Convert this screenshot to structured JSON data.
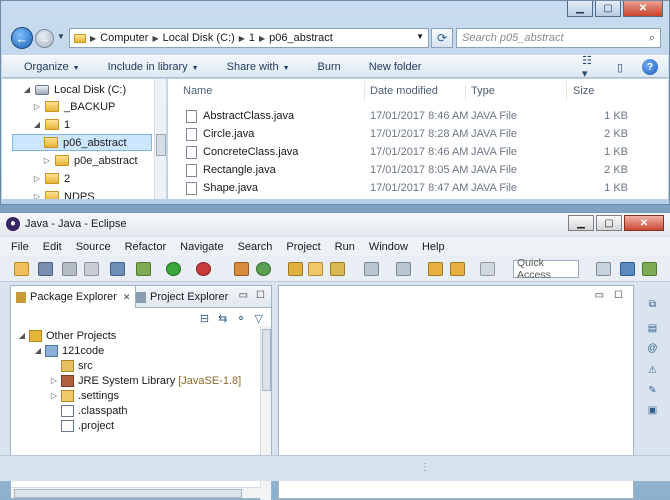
{
  "explorer": {
    "breadcrumb": [
      "Computer",
      "Local Disk (C:)",
      "1",
      "p06_abstract"
    ],
    "search_placeholder": "Search p05_abstract",
    "commands": {
      "organize": "Organize",
      "include": "Include in library",
      "share": "Share with",
      "burn": "Burn",
      "new_folder": "New folder"
    },
    "tree": [
      {
        "label": "Local Disk (C:)",
        "kind": "drive"
      },
      {
        "label": "_BACKUP",
        "kind": "folder"
      },
      {
        "label": "1",
        "kind": "folder"
      },
      {
        "label": "p06_abstract",
        "kind": "folder",
        "selected": true
      },
      {
        "label": "p0e_abstract",
        "kind": "folder"
      },
      {
        "label": "2",
        "kind": "folder"
      },
      {
        "label": "NDPS",
        "kind": "folder"
      }
    ],
    "columns": {
      "name": "Name",
      "date": "Date modified",
      "type": "Type",
      "size": "Size"
    },
    "files": [
      {
        "name": "AbstractClass.java",
        "date": "17/01/2017 8:46 AM",
        "type": "JAVA File",
        "size": "1 KB"
      },
      {
        "name": "Circle.java",
        "date": "17/01/2017 8:28 AM",
        "type": "JAVA File",
        "size": "2 KB"
      },
      {
        "name": "ConcreteClass.java",
        "date": "17/01/2017 8:46 AM",
        "type": "JAVA File",
        "size": "1 KB"
      },
      {
        "name": "Rectangle.java",
        "date": "17/01/2017 8:05 AM",
        "type": "JAVA File",
        "size": "2 KB"
      },
      {
        "name": "Shape.java",
        "date": "17/01/2017 8:47 AM",
        "type": "JAVA File",
        "size": "1 KB"
      }
    ]
  },
  "eclipse": {
    "title": "Java - Java - Eclipse",
    "menus": [
      "File",
      "Edit",
      "Source",
      "Refactor",
      "Navigate",
      "Search",
      "Project",
      "Run",
      "Window",
      "Help"
    ],
    "quick_access": "Quick Access",
    "tabs": {
      "package_explorer": "Package Explorer",
      "project_explorer": "Project Explorer"
    },
    "tree": [
      {
        "label": "Other Projects",
        "suffix": ""
      },
      {
        "label": "121code",
        "suffix": ""
      },
      {
        "label": "src",
        "suffix": ""
      },
      {
        "label": "JRE System Library",
        "suffix": "[JavaSE-1.8]"
      },
      {
        "label": ".settings",
        "suffix": ""
      },
      {
        "label": ".classpath",
        "suffix": ""
      },
      {
        "label": ".project",
        "suffix": ""
      }
    ]
  }
}
